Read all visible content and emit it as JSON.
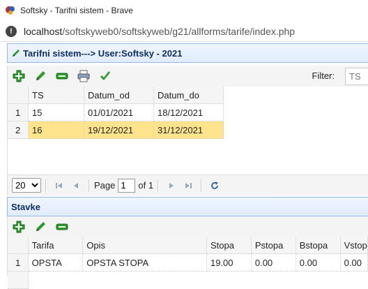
{
  "browser": {
    "window_title": "Softsky - Tarifni sistem - Brave",
    "url_host": "localhost",
    "url_path": "/softskyweb0/softskyweb/g21/allforms/tarife/index.php"
  },
  "main_panel": {
    "title": "Tarifni sistem---> User:Softsky - 2021",
    "toolbar": {
      "buttons": [
        "add-icon",
        "edit-icon",
        "remove-icon",
        "print-icon",
        "save-icon"
      ],
      "filter_label": "Filter:",
      "filter_placeholder": "TS"
    },
    "grid": {
      "columns": [
        "TS",
        "Datum_od",
        "Datum_do"
      ],
      "rows": [
        {
          "num": "1",
          "ts": "15",
          "datum_od": "01/01/2021",
          "datum_do": "18/12/2021",
          "selected": false
        },
        {
          "num": "2",
          "ts": "16",
          "datum_od": "19/12/2021",
          "datum_do": "31/12/2021",
          "selected": true
        }
      ]
    },
    "pager": {
      "page_size": "20",
      "page_label": "Page",
      "page_value": "1",
      "of_label": "of 1"
    }
  },
  "stavke_panel": {
    "title": "Stavke",
    "toolbar": {
      "buttons": [
        "add-icon",
        "edit-icon",
        "remove-icon"
      ]
    },
    "grid": {
      "columns": [
        "Tarifa",
        "Opis",
        "Stopa",
        "Pstopa",
        "Bstopa",
        "Vstop"
      ],
      "rows": [
        {
          "num": "1",
          "tarifa": "OPSTA",
          "opis": "OPSTA STOPA",
          "stopa": "19.00",
          "pstopa": "0.00",
          "bstopa": "0.00",
          "vstop": "0.00"
        }
      ]
    }
  },
  "colors": {
    "header_border": "#95b8e7",
    "header_text": "#0e2d5f",
    "selected_row": "#ffe48d",
    "icon_green": "#2d9a2d"
  }
}
